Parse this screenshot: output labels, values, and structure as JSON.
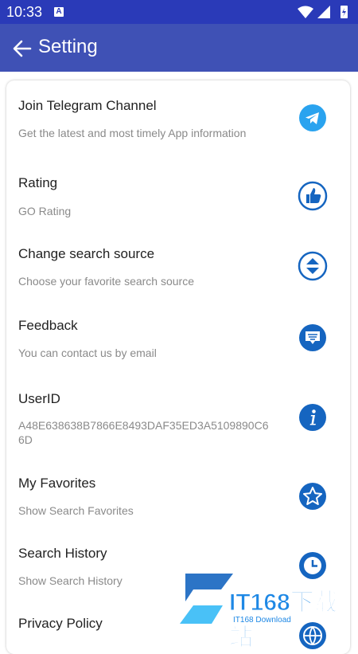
{
  "status_bar": {
    "time": "10:33",
    "notification_letter": "A"
  },
  "app_bar": {
    "title": "Setting",
    "back_icon": "arrow-left-icon"
  },
  "items": [
    {
      "title": "Join Telegram Channel",
      "subtitle": "Get the latest and most timely App information",
      "icon": "telegram-icon"
    },
    {
      "title": "Rating",
      "subtitle": "GO Rating",
      "icon": "thumbs-up-icon"
    },
    {
      "title": "Change search source",
      "subtitle": "Choose your favorite search source",
      "icon": "switch-icon"
    },
    {
      "title": "Feedback",
      "subtitle": "You can contact us by email",
      "icon": "feedback-icon"
    },
    {
      "title": "UserID",
      "subtitle": "A48E638638B7866E8493DAF35ED3A5109890C66D",
      "icon": "info-icon"
    },
    {
      "title": "My Favorites",
      "subtitle": "Show Search Favorites",
      "icon": "star-icon"
    },
    {
      "title": "Search History",
      "subtitle": "Show Search History",
      "icon": "clock-icon"
    },
    {
      "title": "Privacy Policy",
      "subtitle": "",
      "icon": "globe-icon"
    }
  ],
  "watermark": {
    "brand": "IT168下载站",
    "sub": "IT168 Download"
  },
  "colors": {
    "status_bar": "#2a3ab8",
    "app_bar": "#3f51b5",
    "icon_blue": "#1565c0",
    "telegram": "#2aa3ef"
  }
}
